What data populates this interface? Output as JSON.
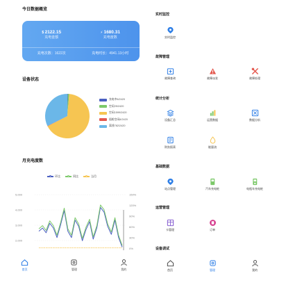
{
  "left": {
    "overview_title": "今日数据概览",
    "card": {
      "charge_amount": "2122.15",
      "charge_amount_label": "充电金额",
      "charge_power": "1680.31",
      "charge_power_label": "充电度数",
      "charge_count": "充电次数：1622次",
      "charge_duration": "充电时长：4941.13小时"
    },
    "device_status_title": "设备状态",
    "pie_legend": [
      {
        "label": "充电中8/2420",
        "color": "#4a5fc1"
      },
      {
        "label": "空闲25/2420",
        "color": "#7dc96a"
      },
      {
        "label": "空闲1599/2420",
        "color": "#f6c552"
      },
      {
        "label": "插枪空闲6/2420",
        "color": "#e4574d"
      },
      {
        "label": "离线782/2420",
        "color": "#6bb7e8"
      }
    ],
    "month_title": "月充电度数",
    "line_legend": [
      {
        "label": "环比",
        "color": "#4a5fc1"
      },
      {
        "label": "同比",
        "color": "#7dc96a"
      },
      {
        "label": "当月",
        "color": "#f6c552"
      }
    ],
    "tabs": [
      {
        "label": "首页",
        "icon": "home-icon",
        "active": true
      },
      {
        "label": "管理",
        "icon": "station-icon",
        "active": false
      },
      {
        "label": "我的",
        "icon": "user-icon",
        "active": false
      }
    ]
  },
  "chart_data": [
    {
      "type": "pie",
      "categories": [
        "充电中",
        "空闲",
        "空闲",
        "插枪空闲",
        "离线"
      ],
      "values": [
        8,
        25,
        1599,
        6,
        782
      ]
    },
    {
      "type": "line",
      "legend": [
        "环比",
        "同比",
        "当月"
      ],
      "y_left_ticks": [
        "5,000",
        "4,000",
        "3,000",
        "2,000"
      ],
      "y_right_ticks": [
        "150%",
        "120%",
        "90%",
        "60%",
        "30%",
        "0%"
      ],
      "ylim": [
        1500,
        5000
      ],
      "series": [
        {
          "name": "环比",
          "values": [
            2700,
            2900,
            2600,
            3200,
            2900,
            2300,
            3100,
            4000,
            2700,
            2300,
            3400,
            3000,
            2100,
            2800,
            3300,
            2200,
            2900,
            4200,
            3900,
            3000,
            2500,
            3400,
            2300,
            1700
          ]
        },
        {
          "name": "同比",
          "values": [
            2850,
            3050,
            2750,
            3350,
            3050,
            2450,
            3250,
            4150,
            2850,
            2450,
            3550,
            3150,
            2250,
            2950,
            3450,
            2350,
            3050,
            4350,
            4050,
            3150,
            2650,
            3550,
            2450,
            1800
          ]
        },
        {
          "name": "当月",
          "values": [
            1650,
            1650,
            1650,
            1650,
            1650,
            1650,
            1650,
            1650,
            1650,
            1650,
            1650,
            1650,
            1650,
            1650,
            1650,
            1650,
            1650,
            1650,
            1650,
            1650,
            1650,
            1650,
            1650,
            1650
          ]
        }
      ]
    }
  ],
  "right": {
    "groups": [
      {
        "title": "实时监控",
        "items": [
          {
            "label": "实时监控",
            "icon": "monitor-icon",
            "color": "#2f7fe6"
          }
        ]
      },
      {
        "title": "故障管理",
        "items": [
          {
            "label": "故障查询",
            "icon": "fault-query-icon",
            "color": "#2f7fe6"
          },
          {
            "label": "故障派发",
            "icon": "warning-icon",
            "color": "#e4574d"
          },
          {
            "label": "故障处理",
            "icon": "wrench-icon",
            "color": "#e4574d"
          }
        ]
      },
      {
        "title": "统计分析",
        "items": [
          {
            "label": "设备汇总",
            "icon": "stack-icon",
            "color": "#2f7fe6"
          },
          {
            "label": "运营数据",
            "icon": "bar-chart-icon",
            "color": "#7dc96a"
          },
          {
            "label": "数据分析",
            "icon": "analysis-icon",
            "color": "#2f7fe6"
          },
          {
            "label": "财务报表",
            "icon": "report-icon",
            "color": "#2f7fe6"
          },
          {
            "label": "能量流",
            "icon": "energy-icon",
            "color": "#f6c552"
          }
        ]
      },
      {
        "title": "基础数据",
        "items": [
          {
            "label": "站点管理",
            "icon": "station-pin-icon",
            "color": "#2f7fe6"
          },
          {
            "label": "汽车充电桩",
            "icon": "car-charger-icon",
            "color": "#7dc96a"
          },
          {
            "label": "电瓶车充电桩",
            "icon": "ebike-charger-icon",
            "color": "#7dc96a"
          }
        ]
      },
      {
        "title": "运营管理",
        "items": [
          {
            "label": "卡管理",
            "icon": "card-icon",
            "color": "#8a63d2"
          },
          {
            "label": "订单",
            "icon": "order-icon",
            "color": "#d4368a"
          }
        ]
      },
      {
        "title": "设备调试",
        "items": [
          {
            "label": "首页",
            "icon": "home-icon",
            "color": "#555555"
          },
          {
            "label": "管理",
            "icon": "station-icon",
            "color": "#2f7fe6"
          },
          {
            "label": "我的",
            "icon": "user-icon",
            "color": "#555555"
          }
        ]
      }
    ]
  }
}
